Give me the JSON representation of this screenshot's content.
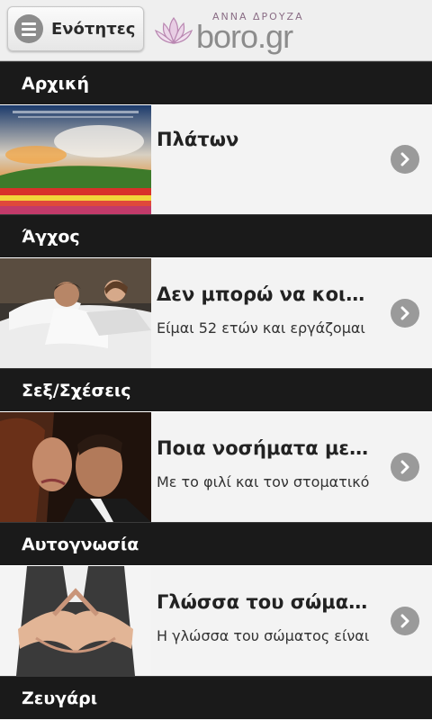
{
  "header": {
    "menu_label": "Ενότητες",
    "logo_sub": "ΑΝΝΑ ΔΡΟΥΖΑ",
    "logo_main": "boro.gr"
  },
  "sections": [
    {
      "label": "Αρχική"
    },
    {
      "label": "Άγχος"
    },
    {
      "label": "Σεξ/Σχέσεις"
    },
    {
      "label": "Αυτογνωσία"
    },
    {
      "label": "Ζευγάρι"
    }
  ],
  "articles": [
    {
      "title": "Πλάτων",
      "description": ""
    },
    {
      "title": "Δεν μπορώ να κοιμηθώ",
      "description": "Είμαι 52 ετών και εργάζομαι"
    },
    {
      "title": "Ποια νοσήματα μεταδίδονται",
      "description": "Με το φιλί και τον στοματικό"
    },
    {
      "title": "Γλώσσα του σώματος",
      "description": "Η γλώσσα του σώματος είναι"
    }
  ],
  "colors": {
    "section_bg": "#1a1a1a",
    "chevron_bg": "#9a9a9a",
    "logo_accent": "#c9a3c4"
  },
  "icons": {
    "menu": "hamburger-menu-icon",
    "chevron": "chevron-right-icon",
    "logo": "lotus-icon"
  }
}
